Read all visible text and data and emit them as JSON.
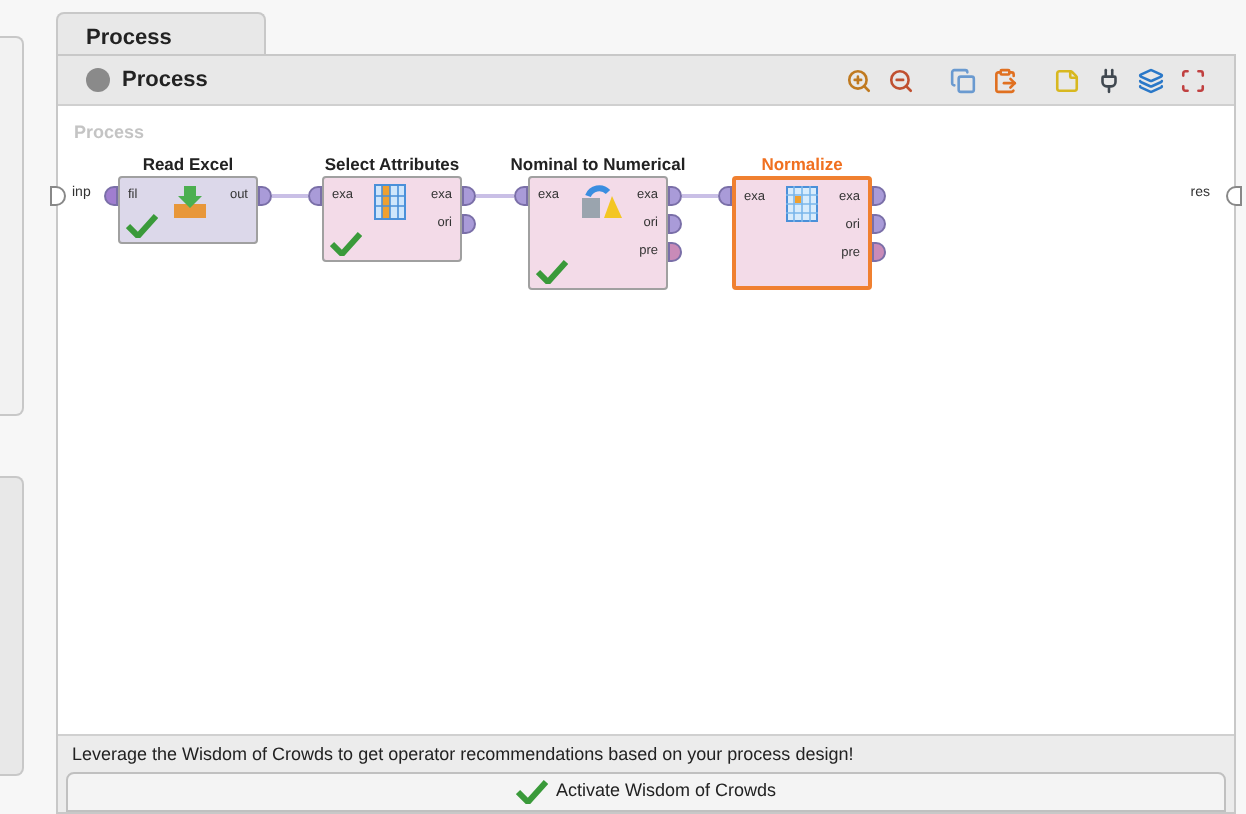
{
  "tabs": [
    {
      "label": "Process",
      "selected": true
    }
  ],
  "header": {
    "title": "Process"
  },
  "canvas": {
    "label": "Process",
    "input_port": "inp",
    "output_port": "res",
    "operators": [
      {
        "name": "Read Excel",
        "selected": false,
        "ok": true,
        "kind": "read",
        "inputs": [
          {
            "label": "fil",
            "color": "#a07ed0"
          }
        ],
        "outputs": [
          {
            "label": "out",
            "color": "#a99bd8"
          }
        ]
      },
      {
        "name": "Select Attributes",
        "selected": false,
        "ok": true,
        "kind": "select",
        "inputs": [
          {
            "label": "exa",
            "color": "#a99bd8"
          }
        ],
        "outputs": [
          {
            "label": "exa",
            "color": "#a99bd8"
          },
          {
            "label": "ori",
            "color": "#a99bd8"
          }
        ]
      },
      {
        "name": "Nominal to Numerical",
        "selected": false,
        "ok": true,
        "kind": "convert",
        "inputs": [
          {
            "label": "exa",
            "color": "#a99bd8"
          }
        ],
        "outputs": [
          {
            "label": "exa",
            "color": "#a99bd8"
          },
          {
            "label": "ori",
            "color": "#a99bd8"
          },
          {
            "label": "pre",
            "color": "#c98bb8"
          }
        ]
      },
      {
        "name": "Normalize",
        "selected": true,
        "ok": false,
        "kind": "normalize",
        "inputs": [
          {
            "label": "exa",
            "color": "#a99bd8"
          }
        ],
        "outputs": [
          {
            "label": "exa",
            "color": "#a99bd8"
          },
          {
            "label": "ori",
            "color": "#a99bd8"
          },
          {
            "label": "pre",
            "color": "#c98bb8"
          }
        ]
      }
    ]
  },
  "recommendation": {
    "text": "Leverage the Wisdom of Crowds to get operator recommendations based on your process design!",
    "button": "Activate Wisdom of Crowds"
  }
}
